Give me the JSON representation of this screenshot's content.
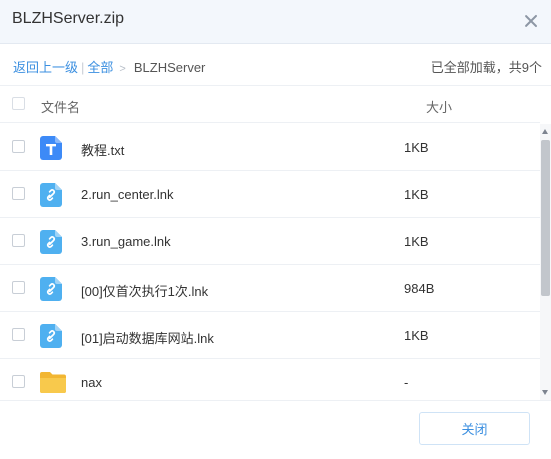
{
  "window": {
    "title": "BLZHServer.zip"
  },
  "breadcrumb": {
    "back_label": "返回上一级",
    "separator": "|",
    "all_label": "全部",
    "arrow": ">",
    "current": "BLZHServer"
  },
  "status": {
    "load_text": "已全部加载，共9个"
  },
  "table": {
    "headers": {
      "name": "文件名",
      "size": "大小"
    },
    "rows": [
      {
        "name": "教程.txt",
        "size": "1KB",
        "icon": "txt-file-icon"
      },
      {
        "name": "2.run_center.lnk",
        "size": "1KB",
        "icon": "link-file-icon"
      },
      {
        "name": "3.run_game.lnk",
        "size": "1KB",
        "icon": "link-file-icon"
      },
      {
        "name": "[00]仅首次执行1次.lnk",
        "size": "984B",
        "icon": "link-file-icon"
      },
      {
        "name": "[01]启动数据库网站.lnk",
        "size": "1KB",
        "icon": "link-file-icon"
      },
      {
        "name": "nax",
        "size": "-",
        "icon": "folder-icon"
      }
    ]
  },
  "footer": {
    "close_label": "关闭"
  },
  "colors": {
    "accent": "#3b8fe0",
    "txt_icon": "#3d8af7",
    "link_icon": "#4fb0f0",
    "folder_icon": "#f8c94c"
  }
}
